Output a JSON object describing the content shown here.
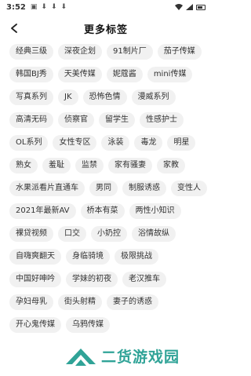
{
  "status": {
    "time": "3:52",
    "notifications": [
      "▣",
      "⬇",
      "⬇",
      "⬇"
    ]
  },
  "header": {
    "title": "更多标签",
    "back_icon": "arrow-left-icon"
  },
  "tags": [
    "经典三级",
    "深夜企划",
    "91制片厂",
    "茄子传媒",
    "韩国BJ秀",
    "天美传媒",
    "妮蔻酱",
    "mini传媒",
    "写真系列",
    "JK",
    "恐怖色情",
    "漫威系列",
    "高清无码",
    "侦察官",
    "留学生",
    "性感护士",
    "OL系列",
    "女性专区",
    "泳装",
    "毒龙",
    "明星",
    "熟女",
    "羞耻",
    "监禁",
    "家有骚妻",
    "家教",
    "水果派看片直通车",
    "男同",
    "制服诱惑",
    "变性人",
    "2021年最新AV",
    "桥本有菜",
    "两性小知识",
    "裸贷视频",
    "口交",
    "小奶控",
    "浴情故纵",
    "自嗨爽翻天",
    "身临骑境",
    "极限挑战",
    "中国好呻吟",
    "学妹的初夜",
    "老汉推车",
    "孕妇母乳",
    "街头射精",
    "妻子的诱惑",
    "开心鬼传媒",
    "乌鸦传媒"
  ],
  "watermark": {
    "text": "二货游戏园",
    "color": "#1f9c8f"
  }
}
